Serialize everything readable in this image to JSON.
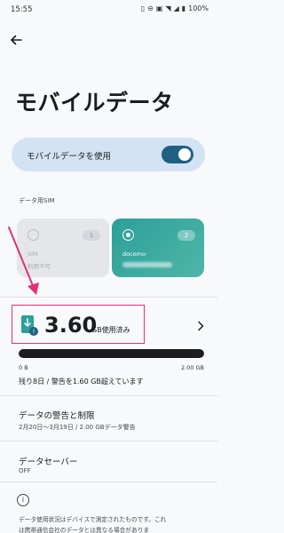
{
  "status_bar": {
    "time": "15:55",
    "battery": "100%"
  },
  "page": {
    "title": "モバイルデータ"
  },
  "mobile_data_toggle": {
    "label": "モバイルデータを使用",
    "enabled": true
  },
  "sim_section": {
    "label": "データ用SIM",
    "cards": [
      {
        "name": "SIM",
        "number": "1",
        "status": "利用不可",
        "selected": false
      },
      {
        "name": "docomo",
        "number": "2",
        "selected": true
      }
    ]
  },
  "usage": {
    "amount": "3.60",
    "unit": "GB使用済み",
    "min_label": "0 B",
    "max_label": "2.00 GB",
    "fill_fraction": 1.0,
    "info": "残り8日 / 警告を1.60 GB超えています"
  },
  "warning_limit": {
    "title": "データの警告と制限",
    "subtitle": "2月20日～3月19日 / 2.00 GBデータ警告"
  },
  "data_saver": {
    "title": "データセーバー",
    "status": "OFF"
  },
  "footer": {
    "line1": "データ使用状況はデバイスで測定されたものです。これ",
    "line2": "は携帯通信会社のデータとは異なる場合がありま"
  },
  "colors": {
    "accent": "#1f6183",
    "highlight": "#e0317a",
    "toggle_card": "#d3e3f3",
    "sim2_card": "#2c9f9a"
  }
}
